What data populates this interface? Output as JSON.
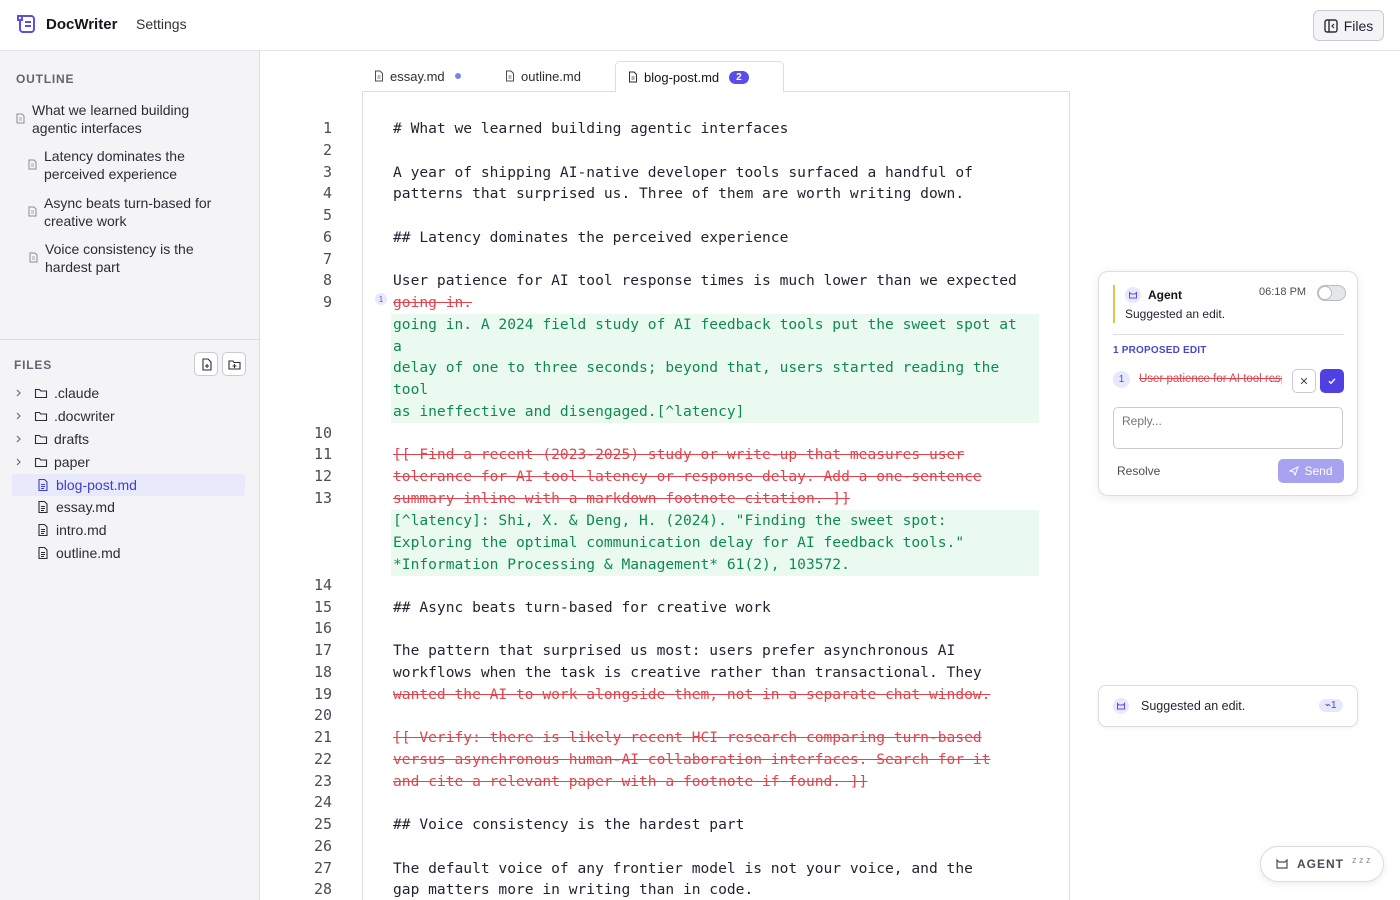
{
  "app": {
    "name": "DocWriter",
    "settings_label": "Settings",
    "files_button": "Files"
  },
  "outline": {
    "title": "OUTLINE",
    "items": [
      {
        "label": "What we learned building agentic interfaces"
      },
      {
        "label": "Latency dominates the perceived experience"
      },
      {
        "label": "Async beats turn-based for creative work"
      },
      {
        "label": "Voice consistency is the hardest part"
      }
    ]
  },
  "files": {
    "title": "FILES",
    "folders": [
      ".claude",
      ".docwriter",
      "drafts",
      "paper"
    ],
    "files": [
      "blog-post.md",
      "essay.md",
      "intro.md",
      "outline.md"
    ],
    "active_file": "blog-post.md"
  },
  "tabs": [
    {
      "label": "essay.md",
      "modified": true
    },
    {
      "label": "outline.md"
    },
    {
      "label": "blog-post.md",
      "badge": "2",
      "active": true
    }
  ],
  "editor": {
    "lines": {
      "l1": "# What we learned building agentic interfaces",
      "l3": "A year of shipping AI-native developer tools surfaced a handful of",
      "l4": "patterns that surprised us. Three of them are worth writing down.",
      "l6": "## Latency dominates the perceived experience",
      "l8": "User patience for AI tool response times is much lower than we expected",
      "l9_del": "going in.",
      "l9_add1": "going in. A 2024 field study of AI feedback tools put the sweet spot at",
      "l9_add2": "a",
      "l9_add3": "delay of one to three seconds; beyond that, users started reading the",
      "l9_add4": "tool",
      "l9_add5": "as ineffective and disengaged.[^latency]",
      "l11_del": "[[ Find a recent (2023-2025) study or write-up that measures user",
      "l12_del": "tolerance for AI tool latency or response delay. Add a one-sentence",
      "l13_del": "summary inline with a markdown footnote citation. ]]",
      "l13_add1": "[^latency]: Shi, X. & Deng, H. (2024). \"Finding the sweet spot:",
      "l13_add2": "Exploring the optimal communication delay for AI feedback tools.\"",
      "l13_add3": "*Information Processing & Management* 61(2), 103572.",
      "l15": "## Async beats turn-based for creative work",
      "l17": "The pattern that surprised us most: users prefer asynchronous AI",
      "l18": "workflows when the task is creative rather than transactional. They",
      "l19_del": "wanted the AI to work alongside them, not in a separate chat window.",
      "l21_del": "[[ Verify: there is likely recent HCI research comparing turn-based",
      "l22_del": "versus asynchronous human-AI collaboration interfaces. Search for it",
      "l23_del": "and cite a relevant paper with a footnote if found. ]]",
      "l25": "## Voice consistency is the hardest part",
      "l27": "The default voice of any frontier model is not your voice, and the",
      "l28": "gap matters more in writing than in code."
    },
    "line_numbers": [
      "1",
      "2",
      "3",
      "4",
      "5",
      "6",
      "7",
      "8",
      "9",
      "10",
      "11",
      "12",
      "13",
      "14",
      "15",
      "16",
      "17",
      "18",
      "19",
      "20",
      "21",
      "22",
      "23",
      "24",
      "25",
      "26",
      "27",
      "28"
    ],
    "marker": "1"
  },
  "agent_card": {
    "name": "Agent",
    "time": "06:18 PM",
    "message": "Suggested an edit.",
    "proposed_title": "1 PROPOSED EDIT",
    "edit_number": "1",
    "edit_preview": "User patience for AI tool response times",
    "ellipsis": "...",
    "reply_placeholder": "Reply...",
    "resolve_label": "Resolve",
    "send_label": "Send"
  },
  "suggestion_card": {
    "text": "Suggested an edit.",
    "badge": "1"
  },
  "agent_fab": {
    "label": "AGENT",
    "status": "z z z"
  },
  "colors": {
    "accent": "#5040e4",
    "deleted": "#e0454e",
    "added": "#0f8a4f",
    "added_bg": "#ebfaf1"
  }
}
